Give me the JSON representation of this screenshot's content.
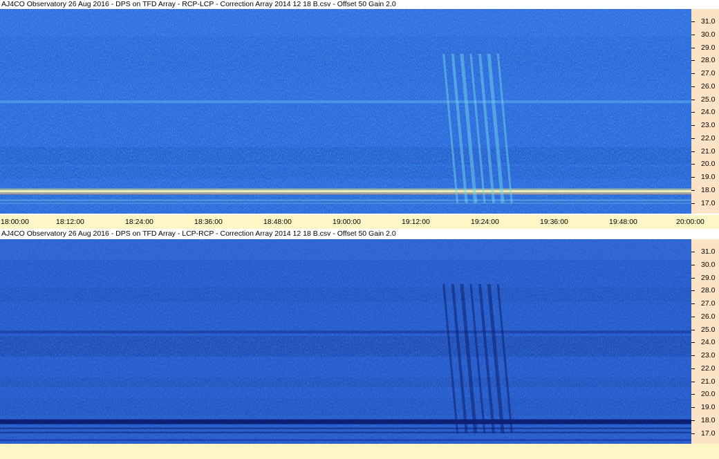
{
  "colors": {
    "background": "#1f5fd6",
    "axis_panel": "#fde3c6",
    "time_axis": "#fdf6c6",
    "emission_band_top": "#f6f0a0",
    "absorption_band_bottom": "#06104a"
  },
  "chart_data": [
    {
      "type": "heatmap",
      "title": "AJ4CO Observatory 26 Aug 2016  -  DPS on TFD Array  -  RCP-LCP  -  Correction Array 2014 12 18 B.csv  -  Offset 50  Gain 2.0",
      "xlabel": "",
      "ylabel": "",
      "x_ticks": [
        "18:00:00",
        "18:12:00",
        "18:24:00",
        "18:36:00",
        "18:48:00",
        "19:00:00",
        "19:12:00",
        "19:24:00",
        "19:36:00",
        "19:48:00",
        "20:00:00"
      ],
      "y_ticks": [
        "31.0",
        "30.0",
        "29.0",
        "28.0",
        "27.0",
        "26.0",
        "25.0",
        "24.0",
        "23.0",
        "22.0",
        "21.0",
        "20.0",
        "19.0",
        "18.0",
        "17.0"
      ],
      "xlim": [
        "18:00:00",
        "20:00:00"
      ],
      "ylim": [
        16.5,
        32.0
      ],
      "features": [
        {
          "kind": "bright-band",
          "freq": 17.9
        },
        {
          "kind": "light-streak",
          "freq": 24.8
        },
        {
          "kind": "burst",
          "time_start": "19:17:00",
          "time_end": "19:28:00",
          "freq_low": 17.0,
          "freq_high": 28.5
        }
      ]
    },
    {
      "type": "heatmap",
      "title": "AJ4CO Observatory 26 Aug 2016  -  DPS on TFD Array  -  LCP-RCP  -  Correction Array 2014 12 18 B.csv  -  Offset 50  Gain 2.0",
      "xlabel": "",
      "ylabel": "",
      "y_ticks": [
        "31.0",
        "30.0",
        "29.0",
        "28.0",
        "27.0",
        "26.0",
        "25.0",
        "24.0",
        "23.0",
        "22.0",
        "21.0",
        "20.0",
        "19.0",
        "18.0",
        "17.0"
      ],
      "xlim": [
        "18:00:00",
        "20:00:00"
      ],
      "ylim": [
        16.5,
        32.0
      ],
      "features": [
        {
          "kind": "dark-band",
          "freq": 17.9
        },
        {
          "kind": "dark-streak",
          "freq": 24.8
        },
        {
          "kind": "burst",
          "time_start": "19:17:00",
          "time_end": "19:28:00",
          "freq_low": 17.0,
          "freq_high": 28.5
        }
      ]
    }
  ]
}
